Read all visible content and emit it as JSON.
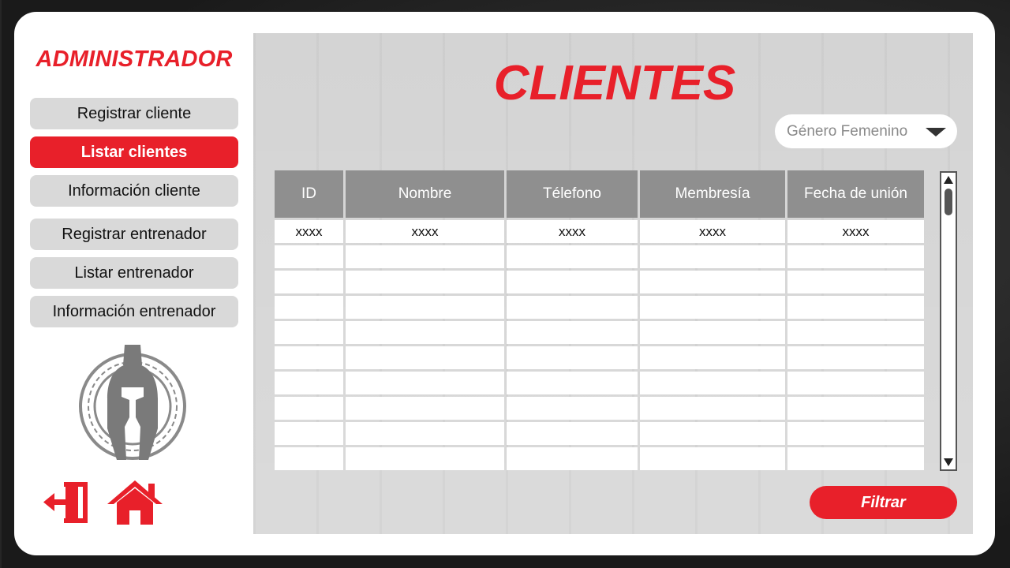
{
  "sidebar": {
    "title": "ADMINISTRADOR",
    "items": [
      {
        "label": "Registrar cliente",
        "active": false
      },
      {
        "label": "Listar clientes",
        "active": true
      },
      {
        "label": "Información cliente",
        "active": false
      },
      {
        "label": "Registrar entrenador",
        "active": false
      },
      {
        "label": "Listar entrenador",
        "active": false
      },
      {
        "label": "Información entrenador",
        "active": false
      }
    ],
    "logo_icon": "spartan-helmet-icon",
    "logout_icon": "logout-door-icon",
    "home_icon": "home-icon"
  },
  "main": {
    "title": "CLIENTES",
    "gender_filter": {
      "selected": "Género Femenino"
    },
    "table": {
      "columns": [
        "ID",
        "Nombre",
        "Télefono",
        "Membresía",
        "Fecha de unión"
      ],
      "rows": [
        [
          "xxxx",
          "xxxx",
          "xxxx",
          "xxxx",
          "xxxx"
        ],
        [
          "",
          "",
          "",
          "",
          ""
        ],
        [
          "",
          "",
          "",
          "",
          ""
        ],
        [
          "",
          "",
          "",
          "",
          ""
        ],
        [
          "",
          "",
          "",
          "",
          ""
        ],
        [
          "",
          "",
          "",
          "",
          ""
        ],
        [
          "",
          "",
          "",
          "",
          ""
        ],
        [
          "",
          "",
          "",
          "",
          ""
        ],
        [
          "",
          "",
          "",
          "",
          ""
        ],
        [
          "",
          "",
          "",
          "",
          ""
        ]
      ]
    },
    "filter_button": "Filtrar"
  },
  "colors": {
    "accent": "#e8202a",
    "button_gray": "#d9d9d9",
    "header_gray": "#8f8f8f",
    "panel_gray": "#d4d4d4"
  }
}
